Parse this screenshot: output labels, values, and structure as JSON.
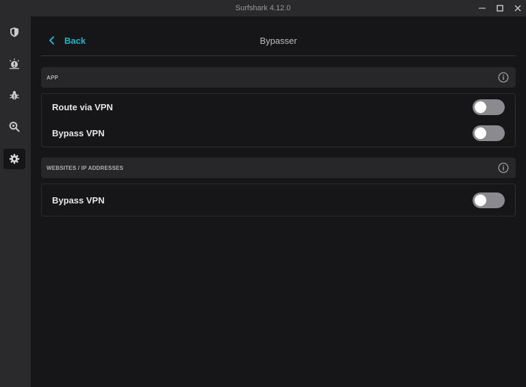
{
  "window": {
    "title": "Surfshark 4.12.0",
    "controls": [
      "minimize-icon",
      "maximize-icon",
      "close-icon"
    ]
  },
  "sidebar": {
    "items": [
      {
        "icon": "shield-icon",
        "active": false
      },
      {
        "icon": "alert-icon",
        "active": false
      },
      {
        "icon": "bug-icon",
        "active": false
      },
      {
        "icon": "search-lock-icon",
        "active": false
      },
      {
        "icon": "gear-icon",
        "active": true
      }
    ]
  },
  "header": {
    "back_label": "Back",
    "title": "Bypasser"
  },
  "sections": [
    {
      "label": "APP",
      "rows": [
        {
          "label": "Route via VPN",
          "enabled": false
        },
        {
          "label": "Bypass VPN",
          "enabled": false
        }
      ]
    },
    {
      "label": "WEBSITES / IP ADDRESSES",
      "rows": [
        {
          "label": "Bypass VPN",
          "enabled": false
        }
      ]
    }
  ],
  "colors": {
    "accent": "#1fb3c6",
    "background": "#161618",
    "sidebar": "#2a2a2c",
    "section_header": "#27272a",
    "toggle_off": "#8a8a8f"
  }
}
